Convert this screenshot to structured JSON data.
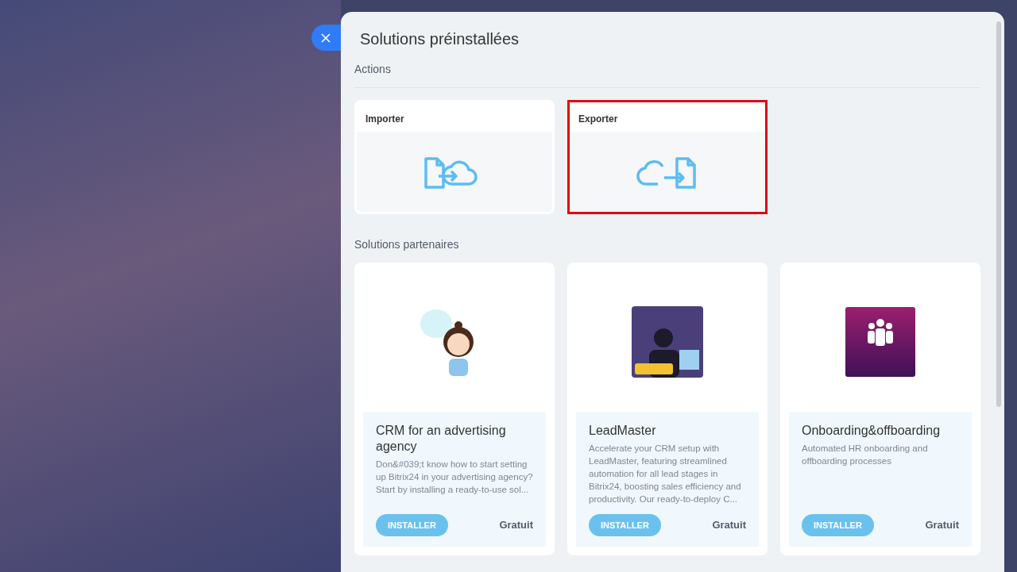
{
  "panel": {
    "title": "Solutions préinstallées"
  },
  "actions_section": {
    "heading": "Actions",
    "items": [
      {
        "kind": "import",
        "label": "Importer",
        "highlighted": false
      },
      {
        "kind": "export",
        "label": "Exporter",
        "highlighted": true
      }
    ]
  },
  "partners_section": {
    "heading": "Solutions partenaires",
    "items": [
      {
        "kind": "character",
        "title": "CRM for an advertising agency",
        "description": "Don&#039;t know how to start setting up Bitrix24 in your advertising agency? Start by installing a ready-to-use sol...",
        "button": "INSTALLER",
        "price": "Gratuit"
      },
      {
        "kind": "scene",
        "title": "LeadMaster",
        "description": "Accelerate your CRM setup with LeadMaster, featuring streamlined automation for all lead stages in Bitrix24, boosting sales efficiency and productivity. Our ready-to-deploy C...",
        "button": "INSTALLER",
        "price": "Gratuit"
      },
      {
        "kind": "team",
        "title": "Onboarding&offboarding",
        "description": "Automated HR onboarding and offboarding processes",
        "button": "INSTALLER",
        "price": "Gratuit"
      }
    ]
  }
}
